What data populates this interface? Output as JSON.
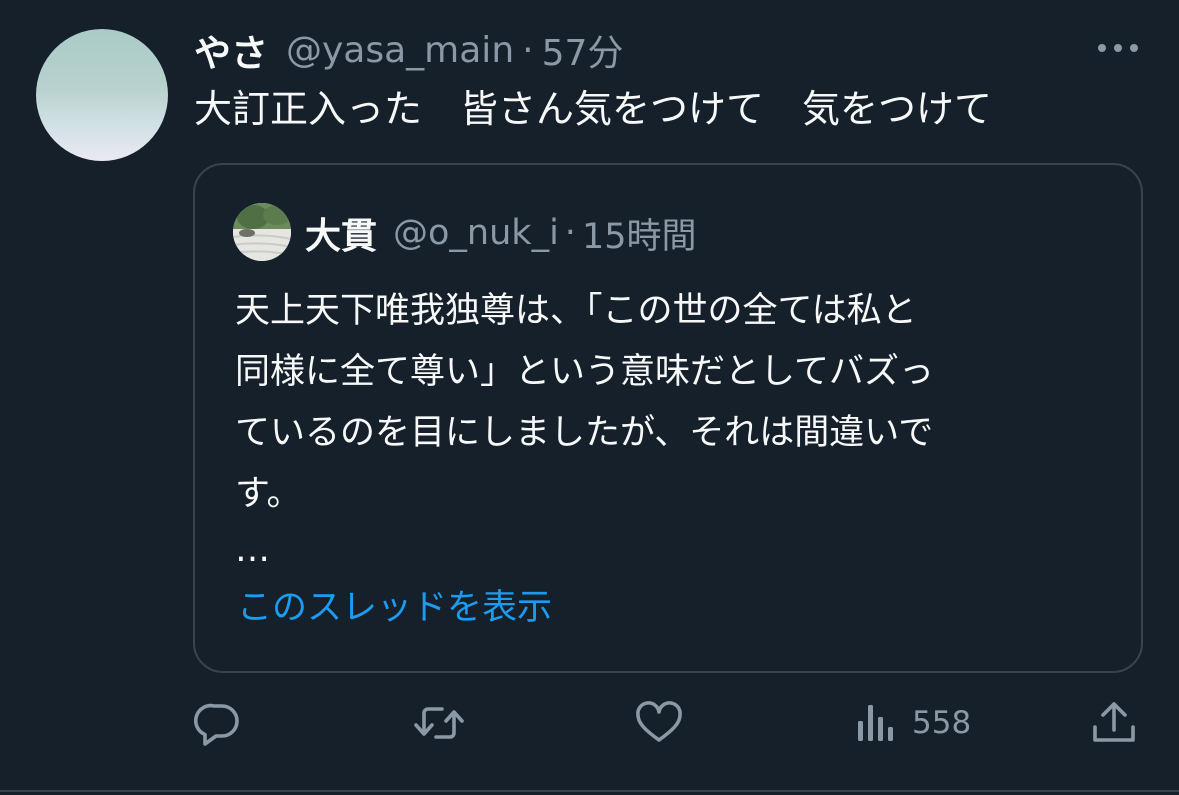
{
  "author": {
    "display_name": "やさ",
    "handle": "@yasa_main",
    "separator": "·",
    "time": "57分"
  },
  "tweet": {
    "text": "大訂正入った　皆さん気をつけて　気をつけて"
  },
  "quoted_tweet": {
    "display_name": "大貫",
    "handle": "@o_nuk_i",
    "separator": "·",
    "time": "15時間",
    "lines": [
      "天上天下唯我独尊は、「この世の全ては私と",
      "同様に全て尊い」という意味だとしてバズっ",
      "ているのを目にしましたが、それは間違いで",
      "す。"
    ],
    "ellipsis": "…",
    "show_thread_label": "このスレッドを表示"
  },
  "actions": {
    "reply_icon": "reply-icon",
    "retweet_icon": "retweet-icon",
    "like_icon": "heart-icon",
    "views_icon": "views-chart-icon",
    "views_count": "558",
    "share_icon": "share-icon"
  },
  "colors": {
    "background": "#15202b",
    "text": "#f7f9f9",
    "muted": "#8b98a5",
    "link": "#1d9bf0",
    "border": "#38444d"
  }
}
